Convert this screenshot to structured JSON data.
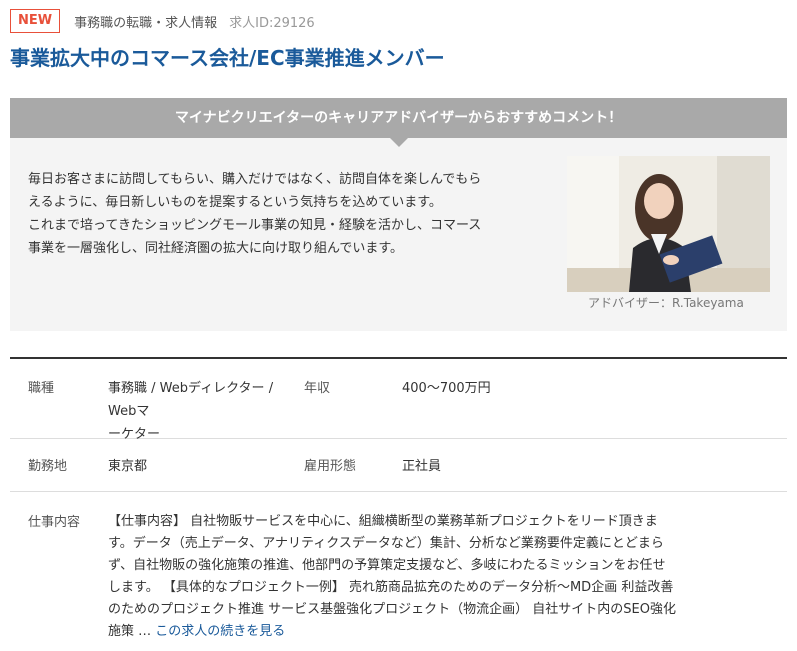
{
  "header": {
    "new_badge": "NEW",
    "category": "事務職の転職・求人情報",
    "job_id": "求人ID:29126"
  },
  "title": "事業拡大中のコマース会社/EC事業推進メンバー",
  "advisor": {
    "banner": "マイナビクリエイターのキャリアアドバイザーからおすすめコメント！",
    "comment_lines": [
      "毎日お客さまに訪問してもらい、購入だけではなく、訪問自体を楽しんでもら",
      "えるように、毎日新しいものを提案するという気持ちを込めています。",
      "これまで培ってきたショッピングモール事業の知見・経験を活かし、コマース",
      "事業を一層強化し、同社経済圏の拡大に向け取り組んでいます。"
    ],
    "caption": "アドバイザー：R.Takeyama"
  },
  "details": {
    "job_type_label": "職種",
    "job_type_lines": [
      "事務職 / Webディレクター / Webマ",
      "ーケター"
    ],
    "salary_label": "年収",
    "salary_value": "400〜700万円",
    "location_label": "勤務地",
    "location_value": "東京都",
    "employment_label": "雇用形態",
    "employment_value": "正社員",
    "work_label": "仕事内容",
    "work_lines": [
      "【仕事内容】 自社物販サービスを中心に、組織横断型の業務革新プロジェクトをリード頂きま",
      "す。データ（売上データ、アナリティクスデータなど）集計、分析など業務要件定義にとどまら",
      "ず、自社物販の強化施策の推進、他部門の予算策定支援など、多岐にわたるミッションをお任せ",
      "します。 【具体的なプロジェクト一例】 売れ筋商品拡充のためのデータ分析〜MD企画 利益改善",
      "のためのプロジェクト推進 サービス基盤強化プロジェクト（物流企画） 自社サイト内のSEO強化"
    ],
    "work_last_line": "施策 … ",
    "read_more": "この求人の続きを見る"
  }
}
